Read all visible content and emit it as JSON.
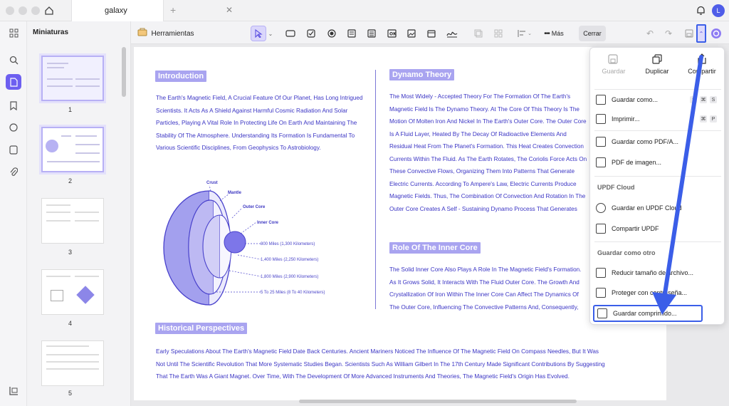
{
  "window": {
    "tab_title": "galaxy",
    "avatar_letter": "L"
  },
  "thumbnails": {
    "title": "Miniaturas",
    "pages": [
      "1",
      "2",
      "3",
      "4",
      "5"
    ]
  },
  "toolbar": {
    "herramientas": "Herramientas",
    "mas": "Más",
    "cerrar": "Cerrar"
  },
  "document": {
    "intro_heading": "Introduction",
    "intro_text": "The Earth's Magnetic Field, A Crucial Feature Of Our Planet, Has Long Intrigued Scientists. It Acts As A Shield Against Harmful Cosmic Radiation And Solar Particles, Playing A Vital Role In Protecting Life On Earth And Maintaining The Stability Of The Atmosphere. Understanding Its Formation Is Fundamental To Various Scientific Disciplines, From Geophysics To Astrobiology.",
    "diagram": {
      "crust": "Crust",
      "mantle": "Mantle",
      "outer_core": "Outer Core",
      "inner_core": "Inner Core",
      "d1": "800 Miles (1,300 Kilometers)",
      "d2": "1,400 Miles (2,250 Kilometers)",
      "d3": "1,800 Miles (2,900 Kilometers)",
      "d4": "5 To 25 Miles (8 To 40 Kilometers)"
    },
    "dynamo_heading": "Dynamo Theory",
    "dynamo_text": "The Most Widely - Accepted Theory For The Formation Of The Earth's Magnetic Field Is The Dynamo Theory. At The Core Of This Theory Is The Motion Of Molten Iron And Nickel In The Earth's Outer Core. The Outer Core Is A Fluid Layer, Heated By The Decay Of Radioactive Elements And Residual Heat From The Planet's Formation. This Heat Creates Convection Currents Within The Fluid. As The Earth Rotates, The Coriolis Force Acts On These Convective Flows, Organizing Them Into Patterns That Generate Electric Currents. According To Ampere's Law, Electric Currents Produce Magnetic Fields. Thus, The Combination Of Convection And Rotation In The Outer Core Creates A Self - Sustaining Dynamo Process That Generates The Earth's Magnetic Field.",
    "inner_heading": "Role Of The Inner Core",
    "inner_text": "The Solid Inner Core Also Plays A Role In The Magnetic Field's Formation. As It Grows Solid, It Interacts With The Fluid Outer Core. The Growth And Crystallization Of Iron Within The Inner Core Can Affect The Dynamics Of The Outer Core, Influencing The Convective Patterns And, Consequently, The Magnetic Field Generation.",
    "hist_heading": "Historical Perspectives",
    "hist_text": "Early Speculations About The Earth's Magnetic Field Date Back Centuries. Ancient Mariners Noticed The Influence Of The Magnetic Field On Compass Needles, But It Was Not Until The Scientific Revolution That More Systematic Studies Began. Scientists Such As William Gilbert In The 17th Century Made Significant Contributions By Suggesting That The Earth Was A Giant Magnet. Over Time, With The Development Of More Advanced Instruments And Theories, The Magnetic Field's Origin Has Evolved."
  },
  "menu": {
    "guardar": "Guardar",
    "duplicar": "Duplicar",
    "compartir": "Compartir",
    "guardar_como": "Guardar como...",
    "guardar_como_kbd": [
      "⇧",
      "⌘",
      "S"
    ],
    "imprimir": "Imprimir...",
    "imprimir_kbd": [
      "⌘",
      "P"
    ],
    "guardar_pdfa": "Guardar como PDF/A...",
    "pdf_imagen": "PDF de imagen...",
    "updf_cloud": "UPDF Cloud",
    "guardar_cloud": "Guardar en UPDF Cloud",
    "compartir_updf": "Compartir UPDF",
    "guardar_como_otro": "Guardar como otro",
    "reducir": "Reducir tamaño de archivo...",
    "proteger": "Proteger con contraseña...",
    "comprimido": "Guardar comprimido..."
  },
  "colors": {
    "accent": "#3b5ee8",
    "heading_bg": "#a9a4f0",
    "text": "#3a34c4"
  }
}
